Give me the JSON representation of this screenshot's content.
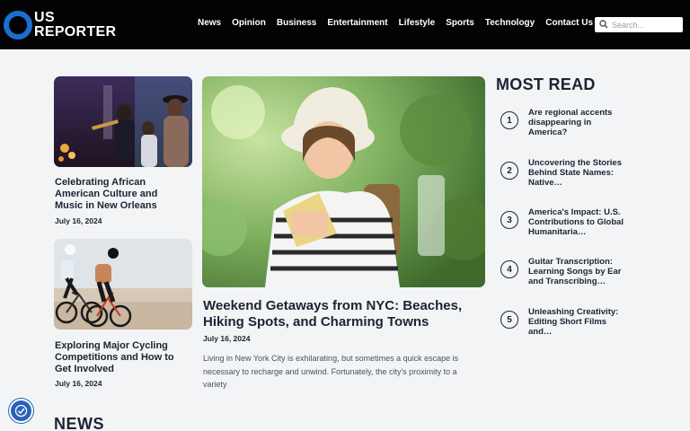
{
  "brand": {
    "logo_top": "US",
    "logo_bottom": "REPORTER",
    "accent": "#1a6fd0"
  },
  "nav": {
    "items": [
      "News",
      "Opinion",
      "Business",
      "Entertainment",
      "Lifestyle",
      "Sports",
      "Technology",
      "Contact Us"
    ]
  },
  "search": {
    "placeholder": "Search...",
    "value": "",
    "icon": "search-icon"
  },
  "left_articles": [
    {
      "title": "Celebrating African American Culture and Music in New Orleans",
      "date": "July 16, 2024"
    },
    {
      "title": "Exploring Major Cycling Competitions and How to Get Involved",
      "date": "July 16, 2024"
    }
  ],
  "featured": {
    "title": "Weekend Getaways from NYC: Beaches, Hiking Spots, and Charming Towns",
    "date": "July 16, 2024",
    "excerpt": "Living in New York City is exhilarating, but sometimes a quick escape is necessary to recharge and unwind. Fortunately, the city's proximity to a variety"
  },
  "most_read": {
    "heading": "MOST READ",
    "items": [
      {
        "num": "1",
        "title": "Are regional accents disappearing in America?"
      },
      {
        "num": "2",
        "title": "Uncovering the Stories Behind State Names: Native…"
      },
      {
        "num": "3",
        "title": "America's Impact: U.S. Contributions to Global Humanitaria…"
      },
      {
        "num": "4",
        "title": "Guitar Transcription: Learning Songs by Ear and Transcribing…"
      },
      {
        "num": "5",
        "title": "Unleashing Creativity: Editing Short Films and…"
      }
    ]
  },
  "news_heading": "NEWS",
  "accessibility": {
    "icon": "accessibility-icon"
  }
}
